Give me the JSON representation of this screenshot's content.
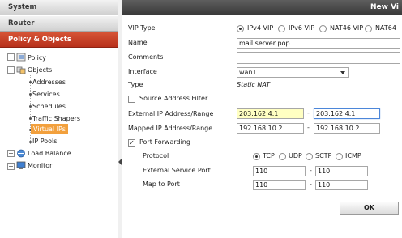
{
  "sidebar": {
    "sections": [
      "System",
      "Router",
      "Policy & Objects"
    ],
    "tree": {
      "policy": "Policy",
      "objects": "Objects",
      "children": [
        "Addresses",
        "Services",
        "Schedules",
        "Traffic Shapers",
        "Virtual IPs",
        "IP Pools"
      ],
      "load_balance": "Load Balance",
      "monitor": "Monitor"
    }
  },
  "dialog": {
    "title": "New Vi",
    "vip_type": {
      "label": "VIP Type",
      "options": [
        "IPv4 VIP",
        "IPv6 VIP",
        "NAT46 VIP",
        "NAT64"
      ],
      "selected": "IPv4 VIP"
    },
    "name": {
      "label": "Name",
      "value": "mail server pop"
    },
    "comments": {
      "label": "Comments",
      "value": ""
    },
    "interface": {
      "label": "Interface",
      "value": "wan1"
    },
    "type": {
      "label": "Type",
      "value": "Static NAT"
    },
    "source_filter": {
      "label": "Source Address Filter",
      "checked": false
    },
    "external_ip": {
      "label": "External IP Address/Range",
      "from": "203.162.4.1",
      "to": "203.162.4.1"
    },
    "mapped_ip": {
      "label": "Mapped IP Address/Range",
      "from": "192.168.10.2",
      "to": "192.168.10.2"
    },
    "port_forwarding": {
      "label": "Port Forwarding",
      "checked": true
    },
    "protocol": {
      "label": "Protocol",
      "options": [
        "TCP",
        "UDP",
        "SCTP",
        "ICMP"
      ],
      "selected": "TCP"
    },
    "external_port": {
      "label": "External Service Port",
      "from": "110",
      "to": "110"
    },
    "map_port": {
      "label": "Map to Port",
      "from": "110",
      "to": "110"
    },
    "dash": "-",
    "ok_label": "OK"
  },
  "colors": {
    "active_section": "#c0392b",
    "selected_item": "#f2a03d",
    "highlight_field": "#ffffc2",
    "title_bar": "#4a4a4a"
  }
}
